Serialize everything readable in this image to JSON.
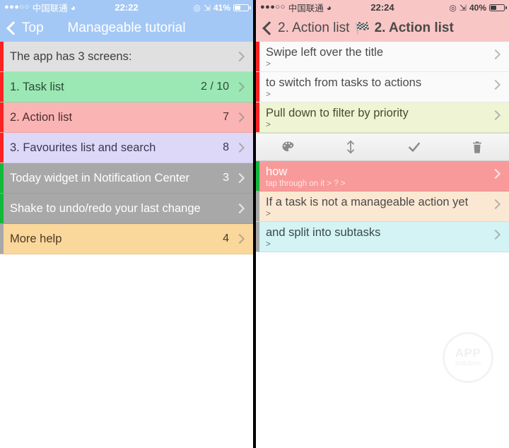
{
  "left_panel": {
    "status_bar": {
      "signal_dots": "●●●○○",
      "carrier": "中国联通",
      "wifi_icon": "wifi-icon",
      "time": "22:22",
      "alarm_icon": "location-icon",
      "bluetooth_icon": "bluetooth-icon",
      "battery_percent": "41%",
      "battery_level": 41
    },
    "nav": {
      "back_label": "Top",
      "title": "Manageable tutorial"
    },
    "rows": [
      {
        "title": "The app has 3 screens:",
        "count": "",
        "bg": "#e0e0e0",
        "edge": "#fb2222",
        "text": "#3f3f3f",
        "light": false
      },
      {
        "title": "1. Task list",
        "count": "2 / 10",
        "bg": "#9be8b4",
        "edge": "#fb2222",
        "text": "#2f4a36",
        "light": false
      },
      {
        "title": "2. Action list",
        "count": "7",
        "bg": "#fbb4b4",
        "edge": "#fb2222",
        "text": "#4a2f2f",
        "light": false
      },
      {
        "title": "3. Favourites list and search",
        "count": "8",
        "bg": "#ddd8f7",
        "edge": "#fb2222",
        "text": "#3a3750",
        "light": false
      },
      {
        "title": "Today widget in Notification Center",
        "count": "3",
        "bg": "#a8a8a8",
        "edge": "#12b83c",
        "text": "#ffffff",
        "light": true
      },
      {
        "title": "Shake to undo/redo your last change",
        "count": "",
        "bg": "#a8a8a8",
        "edge": "#12b83c",
        "text": "#ffffff",
        "light": true
      },
      {
        "title": "More help",
        "count": "4",
        "bg": "#fad79a",
        "edge": "#a8a8a8",
        "text": "#4a3a22",
        "light": false
      }
    ]
  },
  "right_panel": {
    "status_bar": {
      "signal_dots": "●●●○○",
      "carrier": "中国联通",
      "wifi_icon": "wifi-icon",
      "time": "22:24",
      "alarm_icon": "location-icon",
      "bluetooth_icon": "bluetooth-icon",
      "battery_percent": "40%",
      "battery_level": 40
    },
    "nav": {
      "back_label": "2. Action list",
      "flag_icon": "🏁",
      "title": "2. Action list"
    },
    "rows_top": [
      {
        "title": "Swipe left over the title",
        "sub": ">",
        "bg": "#fafafa",
        "edge": "#fb2222",
        "text": "#4a4a4a",
        "light": false
      },
      {
        "title": "to switch from tasks to actions",
        "sub": ">",
        "bg": "#fafafa",
        "edge": "#fb2222",
        "text": "#4a4a4a",
        "light": false
      },
      {
        "title": "Pull down to filter by priority",
        "sub": ">",
        "bg": "#eef4d4",
        "edge": "#fb2222",
        "text": "#4a4a30",
        "light": false
      }
    ],
    "toolbar": [
      {
        "icon": "palette-icon",
        "label": "Colour"
      },
      {
        "icon": "updown-arrow-icon",
        "label": "Reorder"
      },
      {
        "icon": "check-icon",
        "label": "Complete"
      },
      {
        "icon": "trash-icon",
        "label": "Delete"
      }
    ],
    "rows_bottom": [
      {
        "title": "how",
        "sub": "tap through on it > ?  >",
        "bg": "#f99a9a",
        "edge": "#12b83c",
        "text": "#ffffff",
        "light": true
      },
      {
        "title": "If a task is not a manageable action yet",
        "sub": ">",
        "bg": "#fbe8d2",
        "edge": "#a8a8a8",
        "text": "#4a4a4a",
        "light": false
      },
      {
        "title": "and split into subtasks",
        "sub": ">",
        "bg": "#d4f3f5",
        "edge": "#a8a8a8",
        "text": "#3a4a4a",
        "light": false
      }
    ],
    "watermark": {
      "line1": "APP",
      "line2": "solution"
    }
  }
}
